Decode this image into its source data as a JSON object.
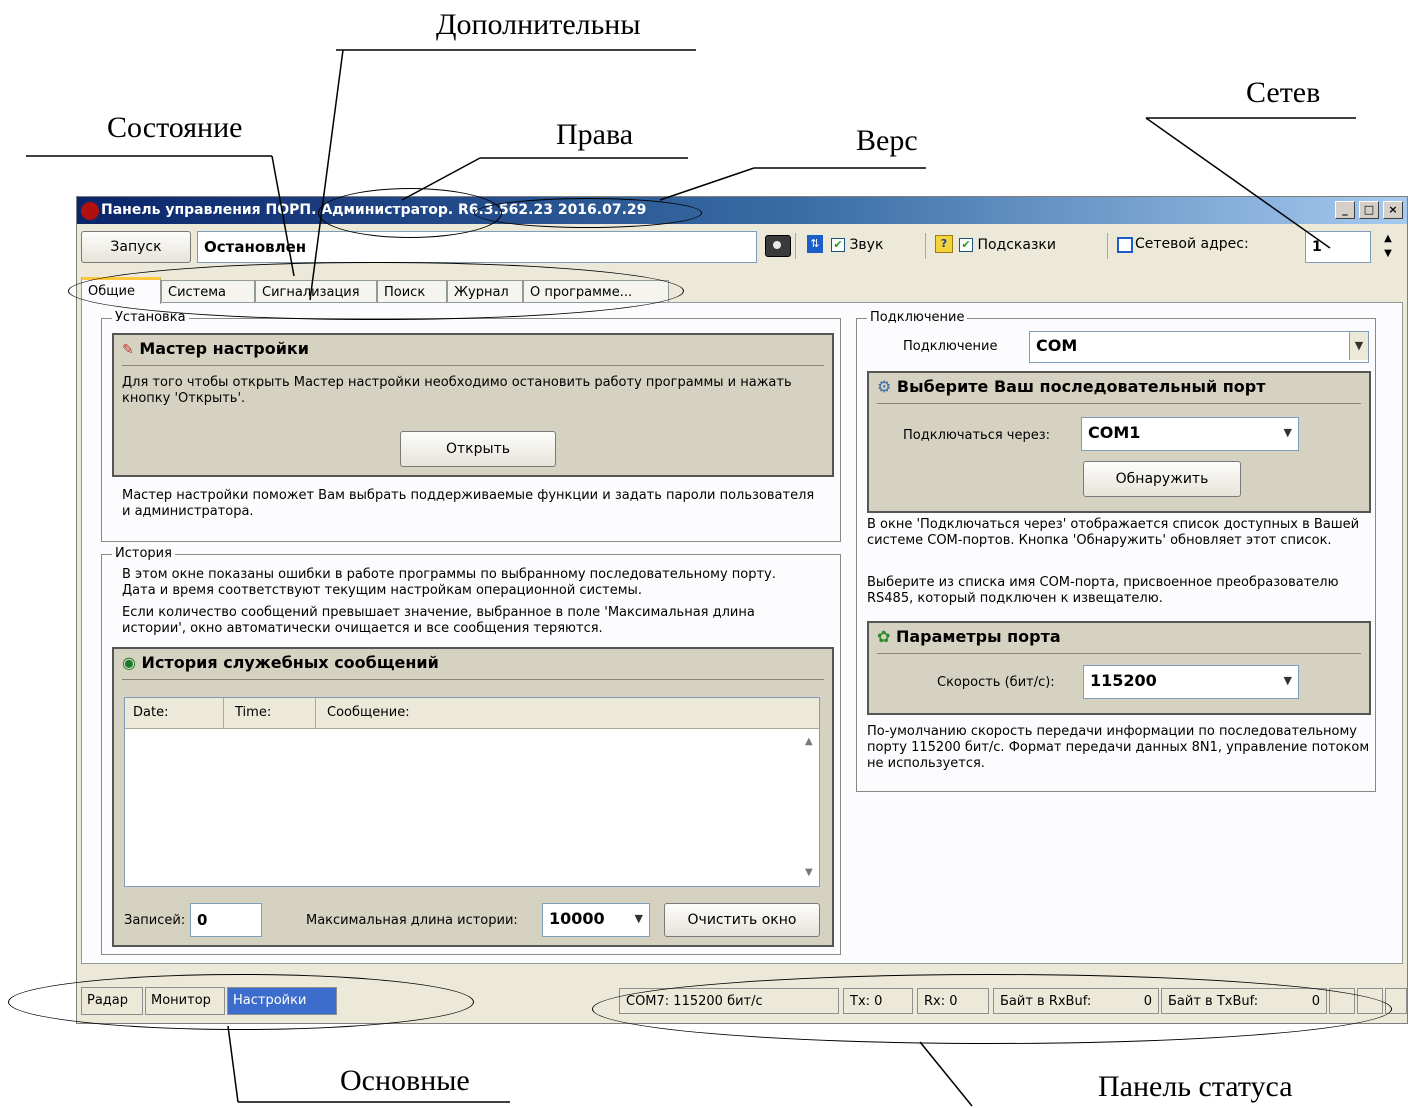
{
  "annotations": {
    "dop": "Дополнительны",
    "setev": "Сетев",
    "sost": "Состояние",
    "prava": "Права",
    "vers": "Верс",
    "osnovnye": "Основные",
    "status_panel": "Панель статуса"
  },
  "window": {
    "title": "Панель управления ПОРП. Администратор. R6.3.562.23 2016.07.29"
  },
  "toolbar": {
    "start_label": "Запуск",
    "state_value": "Остановлен",
    "sound_label": "Звук",
    "hints_label": "Подсказки",
    "net_address_label": "Сетевой адрес:",
    "net_address_value": "1"
  },
  "tabs": [
    "Общие",
    "Система",
    "Сигнализация",
    "Поиск",
    "Журнал",
    "О программе..."
  ],
  "install": {
    "group_label": "Установка",
    "wizard_title": "Мастер настройки",
    "wizard_text": "Для того чтобы открыть Мастер настройки необходимо остановить работу программы и нажать кнопку 'Открыть'.",
    "open_button": "Открыть",
    "help_text": "Мастер настройки поможет Вам выбрать поддерживаемые функции и задать пароли пользователя и администратора."
  },
  "history": {
    "group_label": "История",
    "text1": "В этом окне показаны ошибки в работе программы по выбранному последовательному порту. Дата и время соответствуют текущим настройкам операционной системы.",
    "text2": "Если количество сообщений превышает значение, выбранное в поле 'Максимальная длина истории', окно автоматически очищается и все сообщения теряются.",
    "panel_title": "История служебных сообщений",
    "columns": [
      "Date:",
      "Time:",
      "Сообщение:"
    ],
    "records_label": "Записей:",
    "records_value": "0",
    "maxlen_label": "Максимальная длина истории:",
    "maxlen_value": "10000",
    "clear_button": "Очистить окно"
  },
  "connection": {
    "group_label": "Подключение",
    "conn_label": "Подключение",
    "conn_value": "COM",
    "port_title": "Выберите Ваш последовательный порт",
    "via_label": "Подключаться через:",
    "via_value": "COM1",
    "detect_button": "Обнаружить",
    "text1": "В окне 'Подключаться через' отображается список доступных в Вашей системе COM-портов. Кнопка 'Обнаружить' обновляет этот список.",
    "text2": "Выберите из списка имя COM-порта, присвоенное преобразователю RS485, который подключен к извещателю.",
    "params_title": "Параметры порта",
    "speed_label": "Скорость (бит/с):",
    "speed_value": "115200",
    "text3": "По-умолчанию скорость передачи информации по последовательному порту 115200 бит/с. Формат передачи данных 8N1, управление потоком не используется."
  },
  "bottom_tabs": [
    "Радар",
    "Монитор",
    "Настройки"
  ],
  "status": {
    "com": "COM7: 115200 бит/с",
    "tx": "Tx: 0",
    "rx": "Rx: 0",
    "rxbuf_label": "Байт в RxBuf:",
    "rxbuf_value": "0",
    "txbuf_label": "Байт в TxBuf:",
    "txbuf_value": "0"
  }
}
